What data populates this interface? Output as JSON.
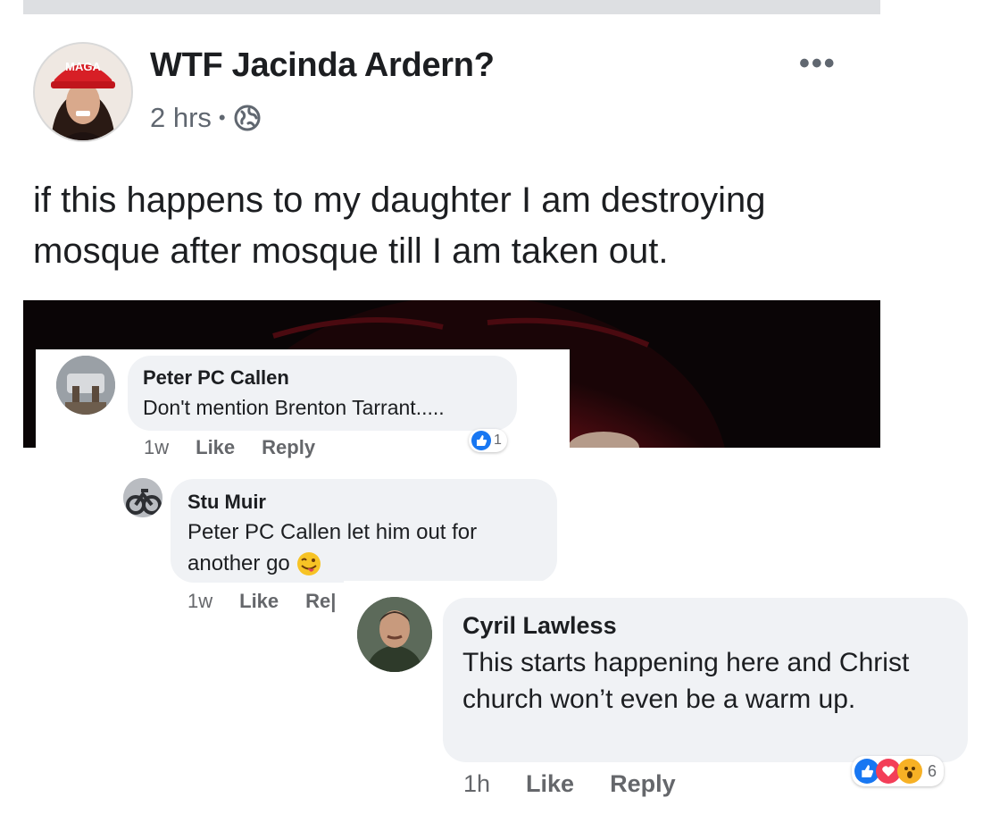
{
  "post": {
    "page_name": "WTF Jacinda Ardern?",
    "time": "2 hrs",
    "separator": "•",
    "more_label": "•••",
    "text": "if this happens to my daughter I am destroying mosque after mosque till I am taken out.",
    "avatar_hat_text": "MAGA"
  },
  "comments": [
    {
      "author": "Peter PC Callen",
      "text": "Don't mention Brenton Tarrant.....",
      "time": "1w",
      "like": "Like",
      "reply": "Reply",
      "reaction_count": "1"
    },
    {
      "author": "Stu Muir",
      "text_line1": "Peter PC Callen let him out for",
      "text_line2": "another go",
      "emoji": "😜",
      "time": "1w",
      "like": "Like",
      "reply": "Re|"
    },
    {
      "author": "Cyril Lawless",
      "text": "This starts happening here and Christ church won’t even be a warm up.",
      "time": "1h",
      "like": "Like",
      "reply": "Reply",
      "reaction_count": "6"
    }
  ],
  "colors": {
    "like_blue": "#1877f2",
    "love_red": "#f33e58",
    "wow_yellow": "#f7b125",
    "bubble": "#f0f2f5",
    "meta_gray": "#606770"
  }
}
